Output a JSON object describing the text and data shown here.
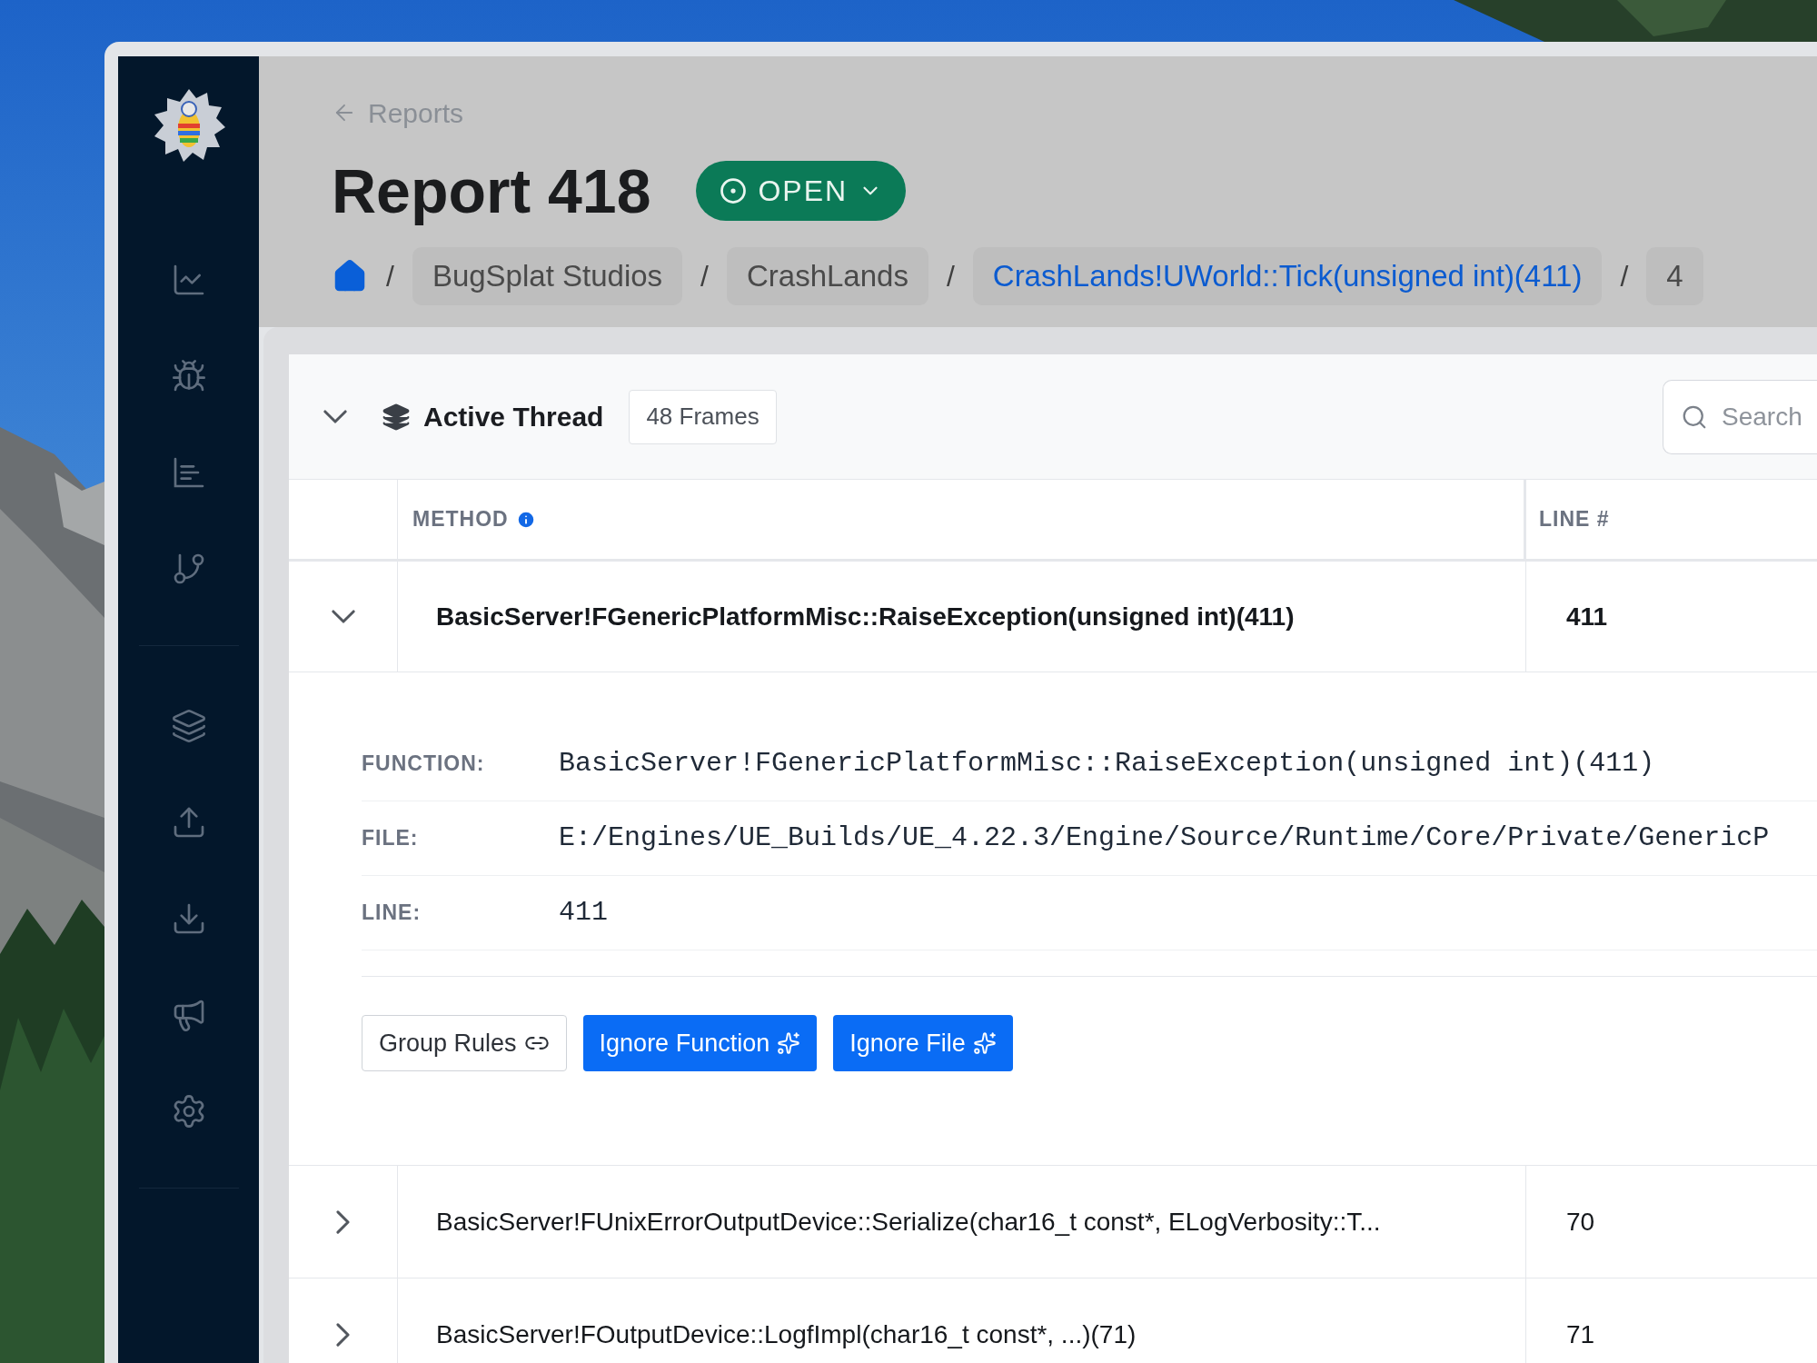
{
  "back_link": {
    "label": "Reports"
  },
  "title": "Report 418",
  "status": {
    "label": "OPEN",
    "kind": "open"
  },
  "breadcrumb_separator": "/",
  "breadcrumb": [
    {
      "label": "BugSplat Studios",
      "current": false
    },
    {
      "label": "CrashLands",
      "current": false
    },
    {
      "label": "CrashLands!UWorld::Tick(unsigned int)(411)",
      "current": true
    },
    {
      "label": "4",
      "current": false
    }
  ],
  "thread": {
    "title": "Active Thread",
    "frames": "48 Frames",
    "expanded": true
  },
  "search": {
    "placeholder": "Search"
  },
  "table": {
    "columns": [
      "METHOD",
      "LINE #"
    ],
    "rows": [
      {
        "method": "BasicServer!FGenericPlatformMisc::RaiseException(unsigned int)(411)",
        "line": "411",
        "expanded": true,
        "details": [
          {
            "label": "FUNCTION:",
            "value": "BasicServer!FGenericPlatformMisc::RaiseException(unsigned int)(411)"
          },
          {
            "label": "FILE:",
            "value": "E:/Engines/UE_Builds/UE_4.22.3/Engine/Source/Runtime/Core/Private/GenericP"
          },
          {
            "label": "LINE:",
            "value": "411"
          }
        ],
        "actions": [
          {
            "label": "Group Rules",
            "kind": "outline"
          },
          {
            "label": "Ignore Function",
            "kind": "primary"
          },
          {
            "label": "Ignore File",
            "kind": "primary"
          }
        ]
      },
      {
        "method": "BasicServer!FUnixErrorOutputDevice::Serialize(char16_t const*, ELogVerbosity::T...",
        "line": "70",
        "expanded": false
      },
      {
        "method": "BasicServer!FOutputDevice::LogfImpl(char16_t const*, ...)(71)",
        "line": "71",
        "expanded": false
      }
    ]
  }
}
